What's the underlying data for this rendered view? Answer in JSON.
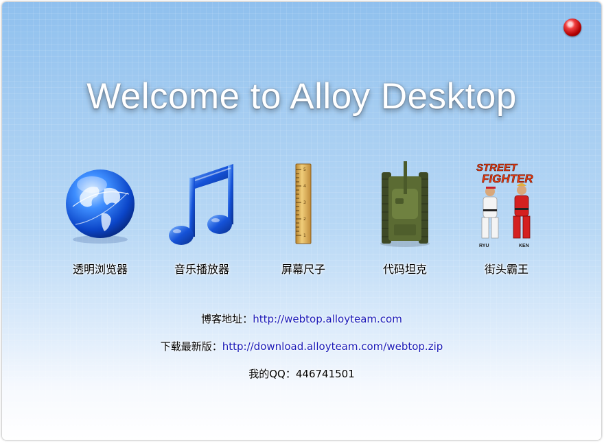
{
  "window": {
    "title": "Welcome to Alloy Desktop"
  },
  "apps": [
    {
      "label": "透明浏览器",
      "icon": "globe-icon"
    },
    {
      "label": "音乐播放器",
      "icon": "music-note-icon"
    },
    {
      "label": "屏幕尺子",
      "icon": "ruler-icon"
    },
    {
      "label": "代码坦克",
      "icon": "tank-icon"
    },
    {
      "label": "街头霸王",
      "icon": "street-fighter-icon",
      "logo_text": [
        "STREET",
        "FIGHTER"
      ],
      "fighter_names": [
        "RYU",
        "KEN"
      ]
    }
  ],
  "info": {
    "blog_label": "博客地址：",
    "blog_url": "http://webtop.alloyteam.com",
    "download_label": "下载最新版：",
    "download_url": "http://download.alloyteam.com/webtop.zip",
    "qq_label": "我的QQ：",
    "qq_value": "446741501"
  },
  "colors": {
    "link": "#1a1ab8",
    "close_button": "#d01010"
  }
}
